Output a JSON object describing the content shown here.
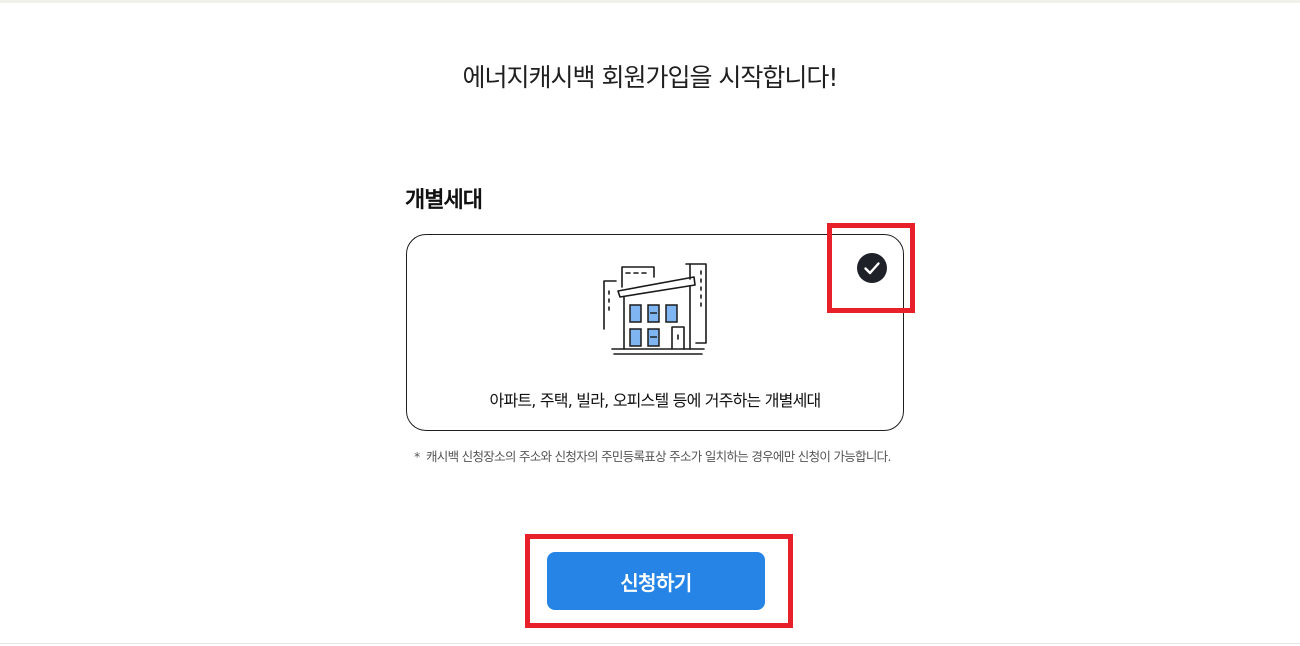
{
  "page": {
    "title": "에너지캐시백 회원가입을 시작합니다!"
  },
  "section": {
    "title": "개별세대"
  },
  "option_card": {
    "description": "아파트, 주택, 빌라, 오피스텔 등에 거주하는 개별세대",
    "icon": "building-icon",
    "selected": true,
    "check_icon": "check-circle-icon"
  },
  "notice": {
    "marker": "*",
    "text": "캐시백 신청장소의 주소와 신청자의 주민등록표상 주소가 일치하는 경우에만 신청이 가능합니다."
  },
  "apply_button": {
    "label": "신청하기"
  },
  "colors": {
    "accent": "#2584e6",
    "highlight": "#e8202a",
    "window_blue": "#7fb6f2",
    "check_bg": "#1e2228"
  }
}
